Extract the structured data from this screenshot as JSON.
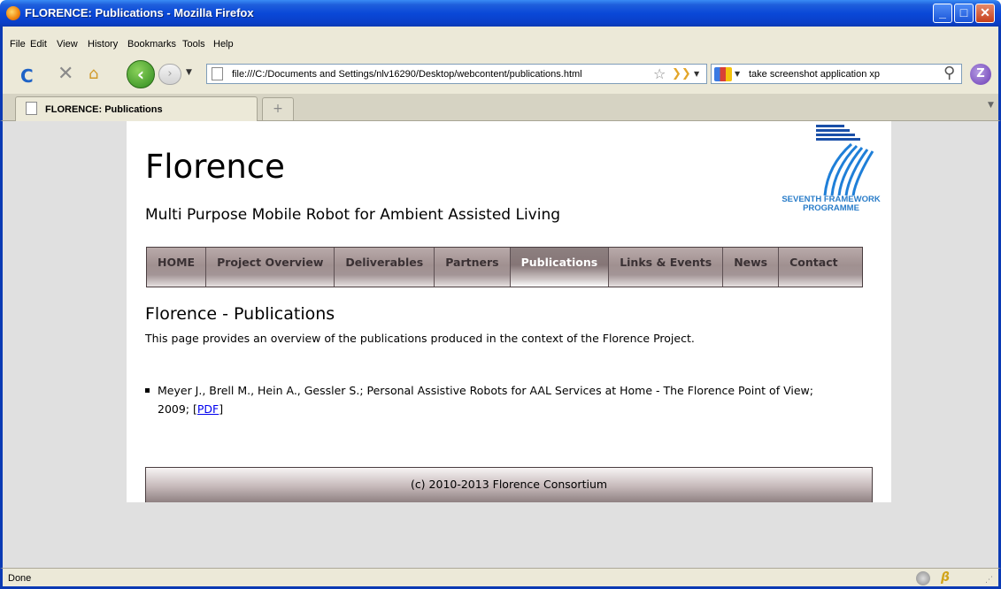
{
  "window": {
    "title": "FLORENCE: Publications - Mozilla Firefox"
  },
  "menubar": {
    "items": [
      "File",
      "Edit",
      "View",
      "History",
      "Bookmarks",
      "Tools",
      "Help"
    ]
  },
  "navbar": {
    "url": "file:///C:/Documents and Settings/nlv16290/Desktop/webcontent/publications.html",
    "search_query": "take screenshot application xp"
  },
  "tabs": [
    {
      "label": "FLORENCE: Publications",
      "active": true
    }
  ],
  "page": {
    "site_title": "Florence",
    "site_subtitle": "Multi Purpose Mobile Robot for Ambient Assisted Living",
    "logo_text": [
      "SEVENTH FRAMEWORK",
      "PROGRAMME"
    ],
    "nav": [
      "HOME",
      "Project Overview",
      "Deliverables",
      "Partners",
      "Publications",
      "Links & Events",
      "News",
      "Contact"
    ],
    "active_nav": "Publications",
    "heading": "Florence - Publications",
    "intro": "This page provides an overview of the publications produced in the context of the Florence Project.",
    "publications": [
      {
        "text": "Meyer J., Brell M., Hein A., Gessler S.; Personal Assistive Robots for AAL Services at Home - The Florence Point of View; 2009; ",
        "link_label": "PDF"
      }
    ],
    "footer": "(c) 2010-2013 Florence Consortium"
  },
  "statusbar": {
    "text": "Done"
  },
  "colors": {
    "nav_active_text": "#ffffff",
    "link": "#0000ee",
    "logo_blue": "#2a7dc9",
    "window_frame": "#0b3ab4"
  }
}
